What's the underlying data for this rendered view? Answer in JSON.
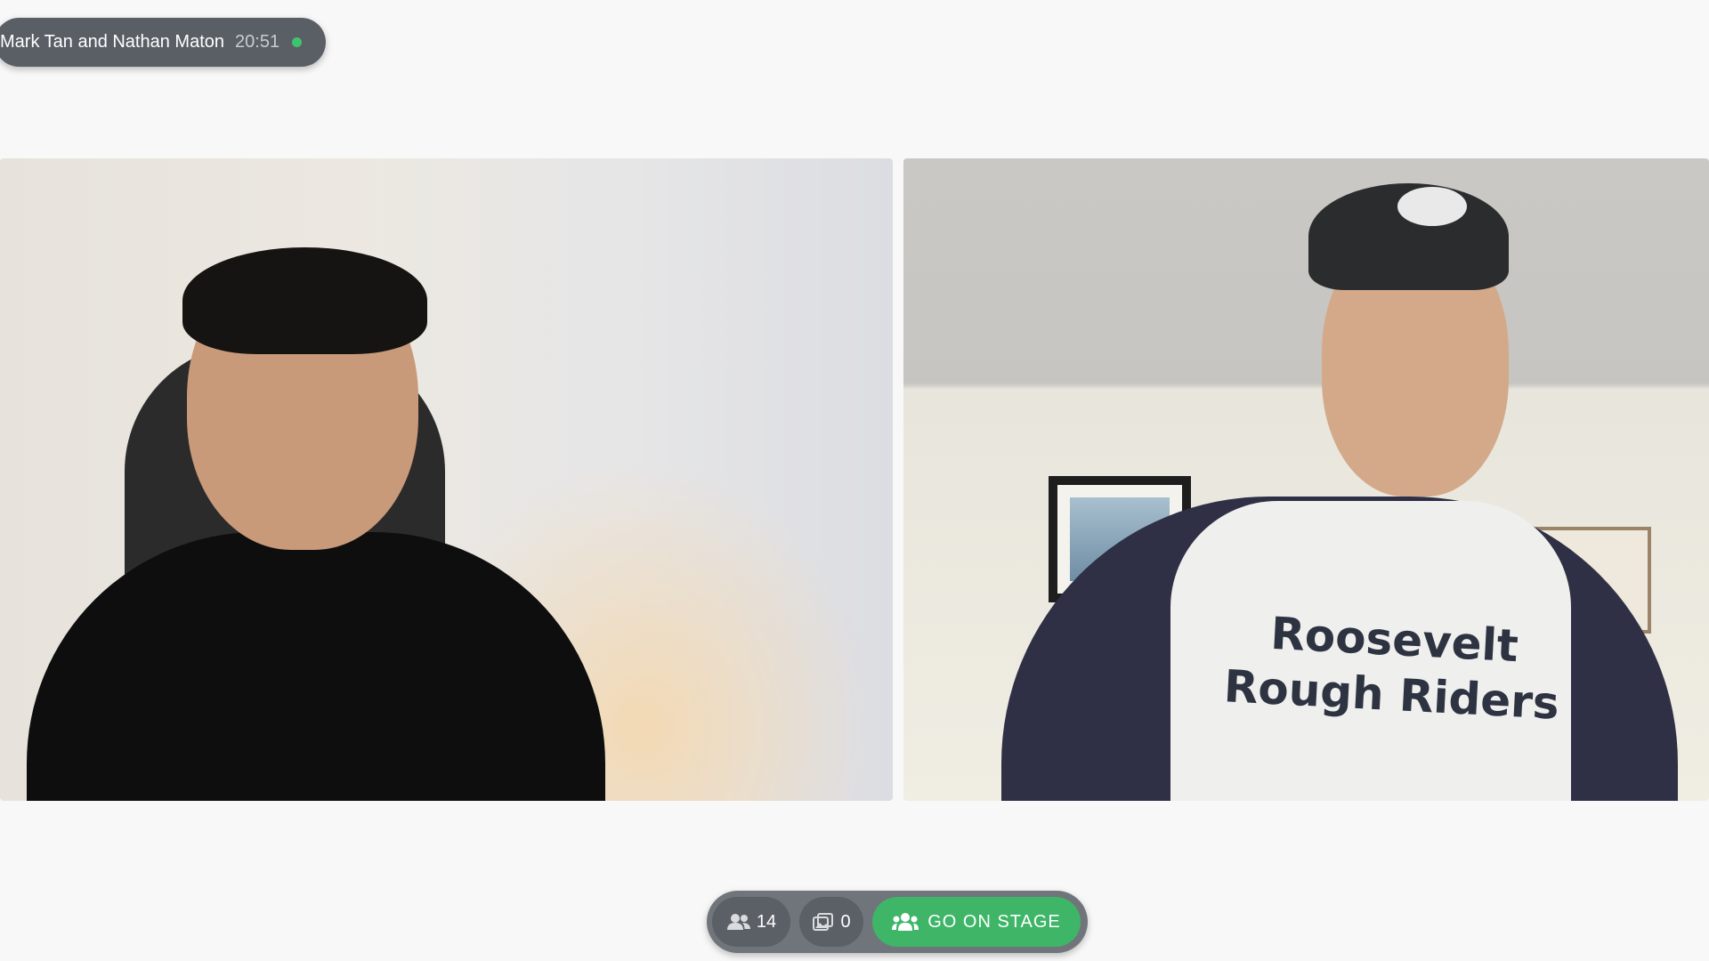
{
  "session": {
    "names": "Mark Tan and Nathan Maton",
    "timer": "20:51",
    "live_color": "#3ec46d"
  },
  "videos": [
    {
      "id": "left",
      "label": ""
    },
    {
      "id": "right",
      "shirt_text_line1": "Roosevelt",
      "shirt_text_line2": "Rough Riders"
    }
  ],
  "controls": {
    "participants_icon": "people-icon",
    "participants_count": "14",
    "media_icon": "media-queue-icon",
    "media_count": "0",
    "stage_icon": "group-icon",
    "stage_label": "GO ON STAGE",
    "stage_color": "#3fb568"
  }
}
